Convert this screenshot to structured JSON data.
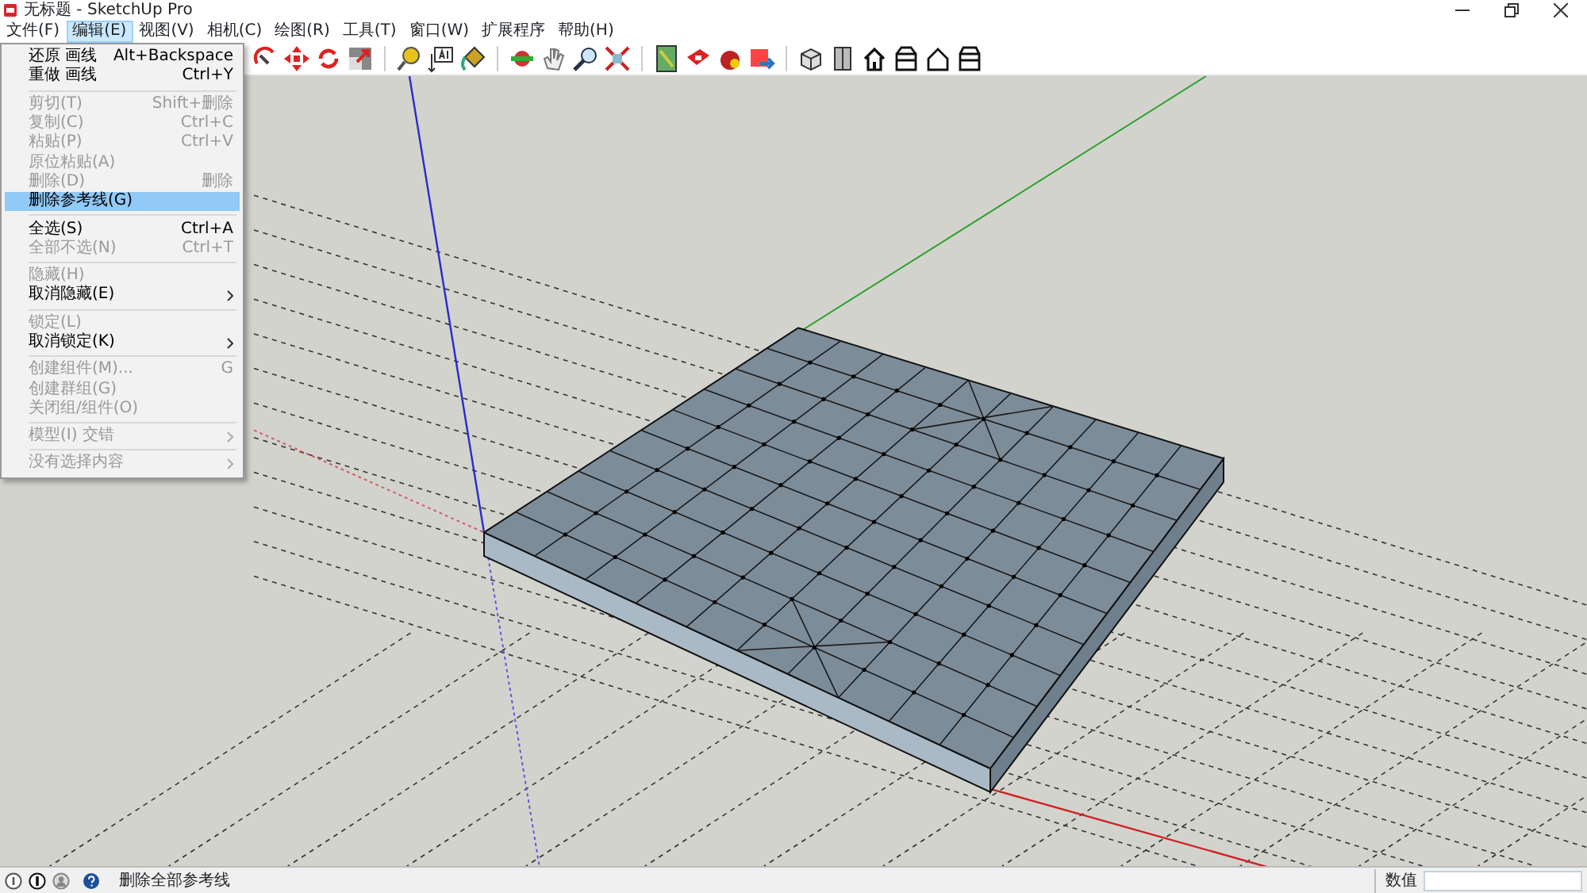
{
  "window": {
    "title": "无标题 - SketchUp Pro"
  },
  "menu_bar": [
    {
      "label": "文件(F)",
      "selected": false
    },
    {
      "label": "编辑(E)",
      "selected": true
    },
    {
      "label": "视图(V)",
      "selected": false
    },
    {
      "label": "相机(C)",
      "selected": false
    },
    {
      "label": "绘图(R)",
      "selected": false
    },
    {
      "label": "工具(T)",
      "selected": false
    },
    {
      "label": "窗口(W)",
      "selected": false
    },
    {
      "label": "扩展程序",
      "selected": false
    },
    {
      "label": "帮助(H)",
      "selected": false
    }
  ],
  "edit_menu": {
    "items": [
      {
        "kind": "item",
        "label": "还原 画线",
        "shortcut": "Alt+Backspace",
        "disabled": false,
        "selected": false,
        "submenu": false
      },
      {
        "kind": "item",
        "label": "重做 画线",
        "shortcut": "Ctrl+Y",
        "disabled": false,
        "selected": false,
        "submenu": false
      },
      {
        "kind": "separator"
      },
      {
        "kind": "item",
        "label": "剪切(T)",
        "shortcut": "Shift+删除",
        "disabled": true,
        "selected": false,
        "submenu": false
      },
      {
        "kind": "item",
        "label": "复制(C)",
        "shortcut": "Ctrl+C",
        "disabled": true,
        "selected": false,
        "submenu": false
      },
      {
        "kind": "item",
        "label": "粘贴(P)",
        "shortcut": "Ctrl+V",
        "disabled": true,
        "selected": false,
        "submenu": false
      },
      {
        "kind": "item",
        "label": "原位粘贴(A)",
        "disabled": true,
        "selected": false,
        "submenu": false
      },
      {
        "kind": "item",
        "label": "删除(D)",
        "shortcut": "删除",
        "disabled": true,
        "selected": false,
        "submenu": false
      },
      {
        "kind": "item",
        "label": "删除参考线(G)",
        "disabled": false,
        "selected": true,
        "submenu": false
      },
      {
        "kind": "separator"
      },
      {
        "kind": "item",
        "label": "全选(S)",
        "shortcut": "Ctrl+A",
        "disabled": false,
        "selected": false,
        "submenu": false
      },
      {
        "kind": "item",
        "label": "全部不选(N)",
        "shortcut": "Ctrl+T",
        "disabled": true,
        "selected": false,
        "submenu": false
      },
      {
        "kind": "separator"
      },
      {
        "kind": "item",
        "label": "隐藏(H)",
        "disabled": true,
        "selected": false,
        "submenu": false
      },
      {
        "kind": "item",
        "label": "取消隐藏(E)",
        "disabled": false,
        "selected": false,
        "submenu": true
      },
      {
        "kind": "separator"
      },
      {
        "kind": "item",
        "label": "锁定(L)",
        "disabled": true,
        "selected": false,
        "submenu": false
      },
      {
        "kind": "item",
        "label": "取消锁定(K)",
        "disabled": false,
        "selected": false,
        "submenu": true
      },
      {
        "kind": "separator"
      },
      {
        "kind": "item",
        "label": "创建组件(M)...",
        "shortcut": "G",
        "disabled": true,
        "selected": false,
        "submenu": false
      },
      {
        "kind": "item",
        "label": "创建群组(G)",
        "disabled": true,
        "selected": false,
        "submenu": false
      },
      {
        "kind": "item",
        "label": "关闭组/组件(O)",
        "disabled": true,
        "selected": false,
        "submenu": false
      },
      {
        "kind": "separator"
      },
      {
        "kind": "item",
        "label": "模型(I) 交错",
        "disabled": true,
        "selected": false,
        "submenu": true
      },
      {
        "kind": "separator"
      },
      {
        "kind": "item",
        "label": "没有选择内容",
        "disabled": true,
        "selected": false,
        "submenu": true
      }
    ]
  },
  "status_bar": {
    "message": "删除全部参考线",
    "measurement_label": "数值"
  }
}
